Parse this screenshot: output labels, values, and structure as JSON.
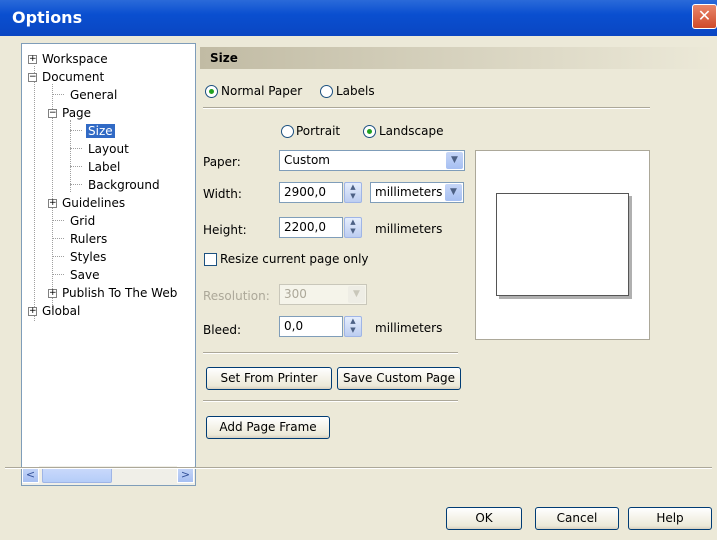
{
  "window": {
    "title": "Options",
    "close_glyph": "✕"
  },
  "tree": {
    "items": [
      {
        "label": "Workspace",
        "expander": "+"
      },
      {
        "label": "Document",
        "expander": "−"
      },
      {
        "label": "General"
      },
      {
        "label": "Page",
        "expander": "−"
      },
      {
        "label": "Size",
        "selected": true
      },
      {
        "label": "Layout"
      },
      {
        "label": "Label"
      },
      {
        "label": "Background"
      },
      {
        "label": "Guidelines",
        "expander": "+"
      },
      {
        "label": "Grid"
      },
      {
        "label": "Rulers"
      },
      {
        "label": "Styles"
      },
      {
        "label": "Save"
      },
      {
        "label": "Publish To The Web",
        "expander": "+"
      },
      {
        "label": "Global",
        "expander": "+"
      }
    ],
    "scroll_left": "<",
    "scroll_right": ">"
  },
  "section": {
    "title": "Size"
  },
  "paper_type": {
    "normal": "Normal Paper",
    "labels": "Labels",
    "selected": "normal"
  },
  "orientation": {
    "portrait": "Portrait",
    "landscape": "Landscape",
    "selected": "landscape"
  },
  "paper": {
    "label": "Paper:",
    "value": "Custom"
  },
  "width": {
    "label": "Width:",
    "value": "2900,0",
    "unit": "millimeters"
  },
  "height": {
    "label": "Height:",
    "value": "2200,0",
    "unit": "millimeters"
  },
  "resize_checkbox": {
    "label": "Resize current page only",
    "checked": false
  },
  "resolution": {
    "label": "Resolution:",
    "value": "300"
  },
  "bleed": {
    "label": "Bleed:",
    "value": "0,0",
    "unit": "millimeters"
  },
  "buttons": {
    "set_from_printer": "Set From Printer",
    "save_custom_page": "Save Custom Page",
    "add_page_frame": "Add Page Frame",
    "ok": "OK",
    "cancel": "Cancel",
    "help": "Help"
  },
  "glyphs": {
    "dropdown": "▼",
    "spin_up": "▲",
    "spin_down": "▼"
  }
}
